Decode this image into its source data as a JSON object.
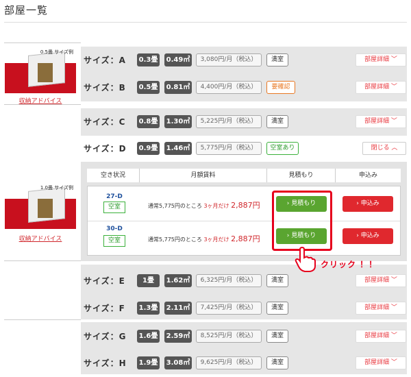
{
  "header": {
    "title": "部屋一覧"
  },
  "thumbs": [
    {
      "size_label": "0.5畳 サイズ例",
      "advice": "収納アドバイス"
    },
    {
      "size_label": "1.0畳 サイズ例",
      "advice": "収納アドバイス"
    }
  ],
  "rows": [
    {
      "size": "サイズ：A",
      "tatami": "0.3畳",
      "area": "0.49㎡",
      "price": "3,080円/月（税込）",
      "status": "満室",
      "detail": "部屋詳細 ﹀"
    },
    {
      "size": "サイズ：B",
      "tatami": "0.5畳",
      "area": "0.81㎡",
      "price": "4,400円/月（税込）",
      "status": "要確認",
      "detail": "部屋詳細 ﹀"
    },
    {
      "size": "サイズ：C",
      "tatami": "0.8畳",
      "area": "1.30㎡",
      "price": "5,225円/月（税込）",
      "status": "満室",
      "detail": "部屋詳細 ﹀"
    },
    {
      "size": "サイズ：D",
      "tatami": "0.9畳",
      "area": "1.46㎡",
      "price": "5,775円/月（税込）",
      "status": "空室あり",
      "detail": "閉じる ︿"
    },
    {
      "size": "サイズ：E",
      "tatami": "1畳",
      "area": "1.62㎡",
      "price": "6,325円/月（税込）",
      "status": "満室",
      "detail": "部屋詳細 ﹀"
    },
    {
      "size": "サイズ：F",
      "tatami": "1.3畳",
      "area": "2.11㎡",
      "price": "7,425円/月（税込）",
      "status": "満室",
      "detail": "部屋詳細 ﹀"
    },
    {
      "size": "サイズ：G",
      "tatami": "1.6畳",
      "area": "2.59㎡",
      "price": "8,525円/月（税込）",
      "status": "満室",
      "detail": "部屋詳細 ﹀"
    },
    {
      "size": "サイズ：H",
      "tatami": "1.9畳",
      "area": "3.08㎡",
      "price": "9,625円/月（税込）",
      "status": "満室",
      "detail": "部屋詳細 ﹀"
    }
  ],
  "detail_table": {
    "headers": [
      "空き状況",
      "月額賃料",
      "見積もり",
      "申込み"
    ],
    "units": [
      {
        "room": "27-D",
        "status": "空室",
        "price_prefix": "通常5,775円のところ",
        "campaign": "3ヶ月だけ",
        "price": "2,887円",
        "estimate": "› 見積もり",
        "apply": "› 申込み"
      },
      {
        "room": "30-D",
        "status": "空室",
        "price_prefix": "通常5,775円のところ",
        "campaign": "3ヶ月だけ",
        "price": "2,887円",
        "estimate": "› 見積もり",
        "apply": "› 申込み"
      }
    ]
  },
  "annotation": {
    "click": "クリック ！！"
  }
}
